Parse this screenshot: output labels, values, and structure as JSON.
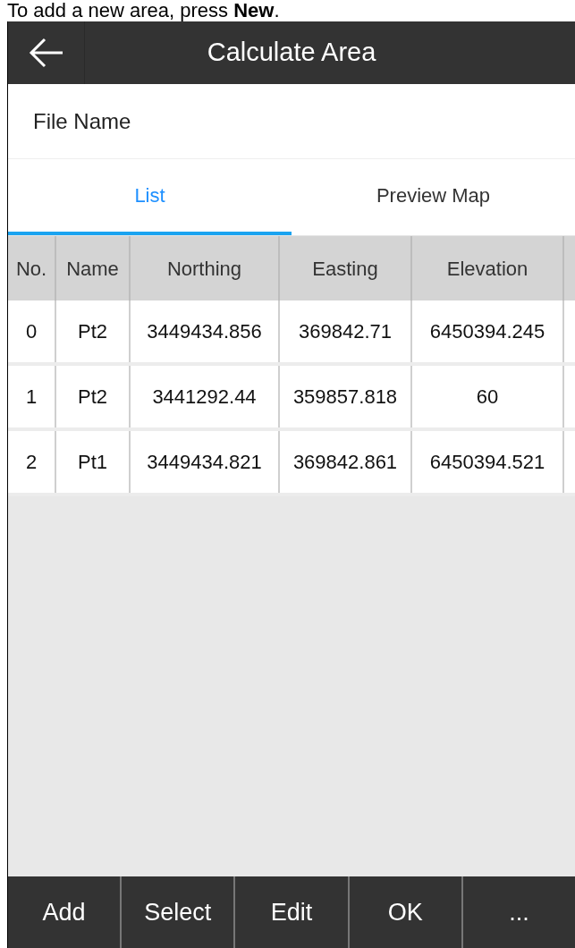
{
  "caption": "To add a new area, press **New**.",
  "app_bar": {
    "title": "Calculate Area"
  },
  "file_name": {
    "label": "File Name"
  },
  "tabs": [
    {
      "label": "List",
      "selected": true
    },
    {
      "label": "Preview Map",
      "selected": false
    }
  ],
  "table": {
    "columns": [
      "No.",
      "Name",
      "Northing",
      "Easting",
      "Elevation"
    ],
    "rows": [
      [
        "0",
        "Pt2",
        "3449434.856",
        "369842.71",
        "6450394.245"
      ],
      [
        "1",
        "Pt2",
        "3441292.44",
        "359857.818",
        "60"
      ],
      [
        "2",
        "Pt1",
        "3449434.821",
        "369842.861",
        "6450394.521"
      ]
    ]
  },
  "buttons": [
    "Add",
    "Select",
    "Edit",
    "OK",
    "..."
  ]
}
